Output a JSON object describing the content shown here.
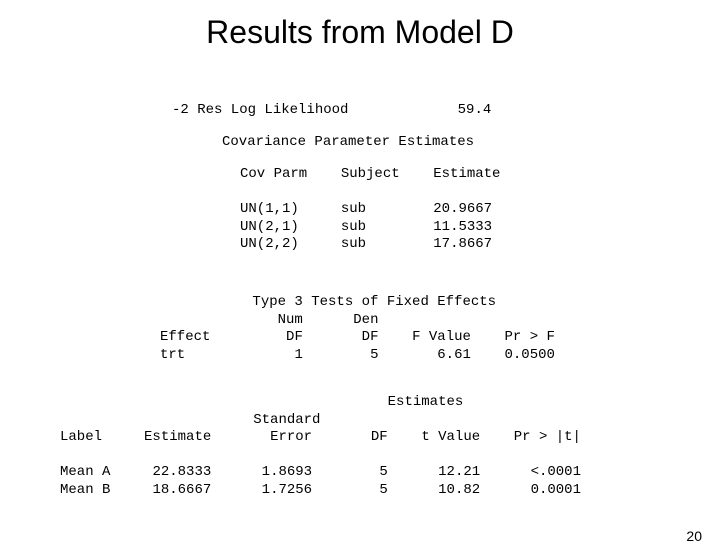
{
  "title": "Results from Model D",
  "ll_label": "-2 Res Log Likelihood",
  "ll_value": "59.4",
  "cov_title": "Covariance Parameter Estimates",
  "cov_hdr": {
    "c1": "Cov Parm",
    "c2": "Subject",
    "c3": "Estimate"
  },
  "cov_rows": [
    {
      "c1": "UN(1,1)",
      "c2": "sub",
      "c3": "20.9667"
    },
    {
      "c1": "UN(2,1)",
      "c2": "sub",
      "c3": "11.5333"
    },
    {
      "c1": "UN(2,2)",
      "c2": "sub",
      "c3": "17.8667"
    }
  ],
  "t3_title": "Type 3 Tests of Fixed Effects",
  "t3_hdr1": {
    "num": "Num",
    "den": "Den"
  },
  "t3_hdr2": {
    "effect": "Effect",
    "df1": "DF",
    "df2": "DF",
    "f": "F Value",
    "p": "Pr > F"
  },
  "t3_row": {
    "effect": "trt",
    "df1": "1",
    "df2": "5",
    "f": "6.61",
    "p": "0.0500"
  },
  "est_title": "Estimates",
  "est_hdr1": {
    "std": "Standard"
  },
  "est_hdr2": {
    "label": "Label",
    "est": "Estimate",
    "err": "Error",
    "df": "DF",
    "t": "t Value",
    "p": "Pr > |t|"
  },
  "est_rows": [
    {
      "label": "Mean A",
      "est": "22.8333",
      "err": "1.8693",
      "df": "5",
      "t": "12.21",
      "p": "<.0001"
    },
    {
      "label": "Mean B",
      "est": "18.6667",
      "err": "1.7256",
      "df": "5",
      "t": "10.82",
      "p": "0.0001"
    }
  ],
  "page_number": "20"
}
